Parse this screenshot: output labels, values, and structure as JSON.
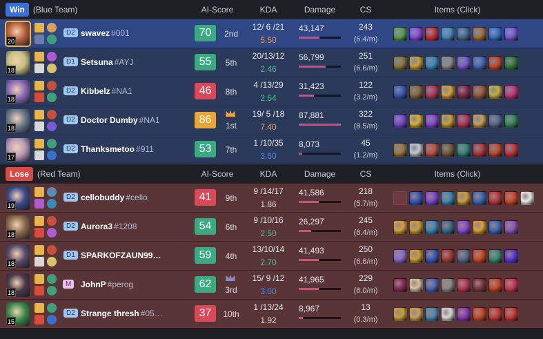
{
  "columns": {
    "ai_score": "AI-Score",
    "kda": "KDA",
    "damage": "Damage",
    "cs": "CS",
    "items": "Items (Click)"
  },
  "blue": {
    "result": "Win",
    "result_color": "#3b6fd8",
    "team": "(Blue Team)",
    "players": [
      {
        "level": "20",
        "tier": "D2",
        "name": "swavez",
        "tag": "#001",
        "score": "70",
        "score_color": "#3da982",
        "rank": "2nd",
        "kda": "12/ 6 /21",
        "ratio": "5.50",
        "ratio_color": "#ff9a4a",
        "damage": "43,147",
        "dmg_frac": 0.49,
        "cs": "243",
        "csm": "(6.4/m)",
        "champ": "#b8603a",
        "spells": [
          "#e8b54a",
          "#6b7ea8"
        ],
        "runes": [
          "#d8a15a",
          "#3ea07a"
        ],
        "items": [
          "#5aa04a",
          "#8a4bd2",
          "#c73333",
          "#4a8ab8",
          "#4b6a8e",
          "#a0703a",
          "#3a70c8",
          "#7a5ad2"
        ],
        "hl": true
      },
      {
        "level": "18",
        "tier": "D1",
        "name": "Setsuna",
        "tag": "#AYJ",
        "score": "55",
        "score_color": "#3da982",
        "rank": "5th",
        "kda": "20/13/12",
        "ratio": "2.46",
        "ratio_color": "#4cc28f",
        "damage": "56,799",
        "dmg_frac": 0.64,
        "cs": "251",
        "csm": "(6.6/m)",
        "champ": "#c8c080",
        "spells": [
          "#e8b54a",
          "#d8d8d8"
        ],
        "runes": [
          "#b05ad0",
          "#d8c36a"
        ],
        "items": [
          "#8a7a3a",
          "#c8a03a",
          "#3a8ab8",
          "#8a8a8a",
          "#7a5ad2",
          "#4a6ab8",
          "#c84a2a",
          "#3a7a3a"
        ]
      },
      {
        "level": "18",
        "tier": "D2",
        "name": "Kibbelz",
        "tag": "#NA1",
        "score": "46",
        "score_color": "#d84a5a",
        "rank": "8th",
        "kda": "4 /13/29",
        "ratio": "2.54",
        "ratio_color": "#4cc28f",
        "damage": "31,423",
        "dmg_frac": 0.36,
        "cs": "122",
        "csm": "(3.2/m)",
        "champ": "#8a6ab8",
        "spells": [
          "#e8b54a",
          "#d84a3a"
        ],
        "runes": [
          "#c8503a",
          "#3ea07a"
        ],
        "items": [
          "#3a5ab8",
          "#8a6a3a",
          "#b83a5a",
          "#d8a03a",
          "#8a2a4a",
          "#a05a3a",
          "#c8b03a",
          "#c83a7a"
        ]
      },
      {
        "level": "18",
        "tier": "D2",
        "name": "Doctor Dumby",
        "tag": "#NA1",
        "score": "86",
        "score_color": "#e8a53a",
        "rank": "1st",
        "crown": true,
        "kda": "19/ 5 /18",
        "ratio": "7.40",
        "ratio_color": "#ff9a4a",
        "damage": "87,881",
        "dmg_frac": 1.0,
        "cs": "322",
        "csm": "(8.5/m)",
        "champ": "#6a7a8a",
        "spells": [
          "#e8b54a",
          "#d8d8d8"
        ],
        "runes": [
          "#c8503a",
          "#7a5ad2"
        ],
        "items": [
          "#7a4ad2",
          "#d8b03a",
          "#8a4ad2",
          "#c8a03a",
          "#b83a5a",
          "#c8a05a",
          "#5a6a8a",
          "#3a8a5a"
        ]
      },
      {
        "level": "17",
        "tier": "D2",
        "name": "Thanksmetoo",
        "tag": "#911",
        "score": "53",
        "score_color": "#3da982",
        "rank": "7th",
        "kda": "1 /10/35",
        "ratio": "3.60",
        "ratio_color": "#4a8ae8",
        "damage": "8,073",
        "dmg_frac": 0.09,
        "cs": "45",
        "csm": "(1.2/m)",
        "champ": "#b89ab8",
        "spells": [
          "#e8b54a",
          "#d8d8d8"
        ],
        "runes": [
          "#3ea07a",
          "#3a70c8"
        ],
        "items": [
          "#a07a3a",
          "#c8c8c8",
          "#c8503a",
          "#7a5a3a",
          "#3a8a7a",
          "#b83a3a",
          "#c84a2a",
          "#c83a3a"
        ]
      }
    ]
  },
  "red": {
    "result": "Lose",
    "result_color": "#d84a4a",
    "team": "(Red Team)",
    "players": [
      {
        "level": "19",
        "tier": "D2",
        "name": "cellobuddy",
        "tag": "#cello",
        "score": "41",
        "score_color": "#d84a5a",
        "rank": "9th",
        "kda": "9 /14/17",
        "ratio": "1.86",
        "ratio_color": "#d8d8d8",
        "damage": "41,586",
        "dmg_frac": 0.47,
        "cs": "218",
        "csm": "(5.7/m)",
        "champ": "#3a4a8a",
        "spells": [
          "#e8b54a",
          "#b05ad0"
        ],
        "runes": [
          "#5a8ab8",
          "#3a8ab8"
        ],
        "items": [
          "empty",
          "#3a5ab8",
          "#7a4ad2",
          "#3a8ab8",
          "#c8a03a",
          "#3a6ab8",
          "#b83a3a",
          "#c84a2a",
          "#e8e8e8"
        ]
      },
      {
        "level": "18",
        "tier": "D2",
        "name": "Aurora3",
        "tag": "#1208",
        "score": "54",
        "score_color": "#3da982",
        "rank": "6th",
        "kda": "9 /10/16",
        "ratio": "2.50",
        "ratio_color": "#4cc28f",
        "damage": "26,297",
        "dmg_frac": 0.3,
        "cs": "245",
        "csm": "(6.4/m)",
        "champ": "#8a6a4a",
        "spells": [
          "#e8b54a",
          "#d84a3a"
        ],
        "runes": [
          "#c8503a",
          "#b05ad0"
        ],
        "items": [
          "#d8a03a",
          "#c8a03a",
          "#3a8ab8",
          "#3a6a8a",
          "#8a4ad2",
          "#d8a03a",
          "#3a6ab8",
          "#8a5ab8"
        ]
      },
      {
        "level": "18",
        "tier": "D1",
        "name": "SPARKOFZAUN99…",
        "tag": "",
        "score": "59",
        "score_color": "#3da982",
        "rank": "4th",
        "kda": "13/10/14",
        "ratio": "2.70",
        "ratio_color": "#4cc28f",
        "damage": "41,493",
        "dmg_frac": 0.47,
        "cs": "250",
        "csm": "(6.6/m)",
        "champ": "#5a4a6a",
        "spells": [
          "#e8b54a",
          "#d8d8d8"
        ],
        "runes": [
          "#c8503a",
          "#d8c36a"
        ],
        "items": [
          "#8a6ad2",
          "#c8a03a",
          "#3a5ab8",
          "#a03a3a",
          "#5a6a8a",
          "#c84a2a",
          "#3a8a7a",
          "#5a3ad2"
        ]
      },
      {
        "level": "18",
        "tier": "M",
        "name": "JohnP",
        "tag": "#perog",
        "score": "62",
        "score_color": "#3da982",
        "rank": "3rd",
        "crown": true,
        "kda": "15/ 9 /12",
        "ratio": "3.00",
        "ratio_color": "#4a8ae8",
        "damage": "41,965",
        "dmg_frac": 0.48,
        "cs": "229",
        "csm": "(6.0/m)",
        "champ": "#4a3a4a",
        "spells": [
          "#e8b54a",
          "#d84a3a"
        ],
        "runes": [
          "#3ea07a",
          "#3ea07a"
        ],
        "items": [
          "#8a2a5a",
          "#d8c0a0",
          "#4a6ab8",
          "#8a8a8a",
          "#b83a5a",
          "#7a3a3a",
          "#c84a2a",
          "#c83a5a"
        ]
      },
      {
        "level": "15",
        "tier": "D2",
        "name": "Strange thresh",
        "tag": "#05…",
        "score": "37",
        "score_color": "#d84a5a",
        "rank": "10th",
        "kda": "1 /13/24",
        "ratio": "1.92",
        "ratio_color": "#d8d8d8",
        "damage": "8,967",
        "dmg_frac": 0.1,
        "cs": "13",
        "csm": "(0.3/m)",
        "champ": "#3a8a4a",
        "spells": [
          "#e8b54a",
          "#d84a3a"
        ],
        "runes": [
          "#3ea07a",
          "#3a70c8"
        ],
        "items": [
          "#c8a03a",
          "#c8a05a",
          "#4a8ab8",
          "#d8d8d8",
          "#8a3ab8",
          "#c84a2a",
          "#c83a3a",
          "#c83a3a"
        ]
      }
    ]
  }
}
